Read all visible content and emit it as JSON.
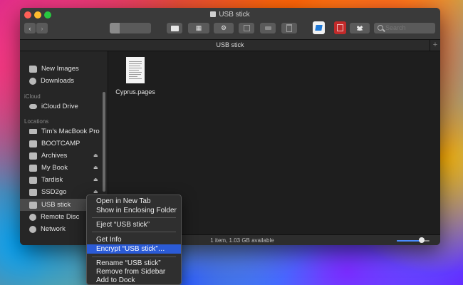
{
  "window": {
    "title": "USB stick"
  },
  "toolbar": {
    "back": "‹",
    "forward": "›",
    "action": "⚙",
    "arrange": "▦",
    "search_placeholder": "Search"
  },
  "pathbar": {
    "label": "USB stick",
    "plus": "+"
  },
  "sidebar": {
    "sections": {
      "icloud": "iCloud",
      "locations": "Locations"
    },
    "items": [
      {
        "label": "New Images"
      },
      {
        "label": "Downloads"
      },
      {
        "label": "iCloud Drive"
      },
      {
        "label": "Tim's MacBook Pro"
      },
      {
        "label": "BOOTCAMP"
      },
      {
        "label": "Archives"
      },
      {
        "label": "My Book"
      },
      {
        "label": "Tardisk"
      },
      {
        "label": "SSD2go"
      },
      {
        "label": "USB stick"
      },
      {
        "label": "Remote Disc"
      },
      {
        "label": "Network"
      }
    ],
    "eject": "⏏"
  },
  "files": [
    {
      "name": "Cyprus.pages"
    }
  ],
  "status": {
    "text": "1 item, 1.03 GB available",
    "zoom_fraction": 0.75
  },
  "context_menu": {
    "items": [
      {
        "label": "Open in New Tab"
      },
      {
        "label": "Show in Enclosing Folder"
      },
      {
        "label": "Eject “USB stick”"
      },
      {
        "label": "Get Info"
      },
      {
        "label": "Encrypt “USB stick”…"
      },
      {
        "label": "Rename “USB stick”"
      },
      {
        "label": "Remove from Sidebar"
      },
      {
        "label": "Add to Dock"
      }
    ]
  },
  "colors": {
    "highlight": "#2b5bd7",
    "window_bg": "#1e1e1e"
  }
}
